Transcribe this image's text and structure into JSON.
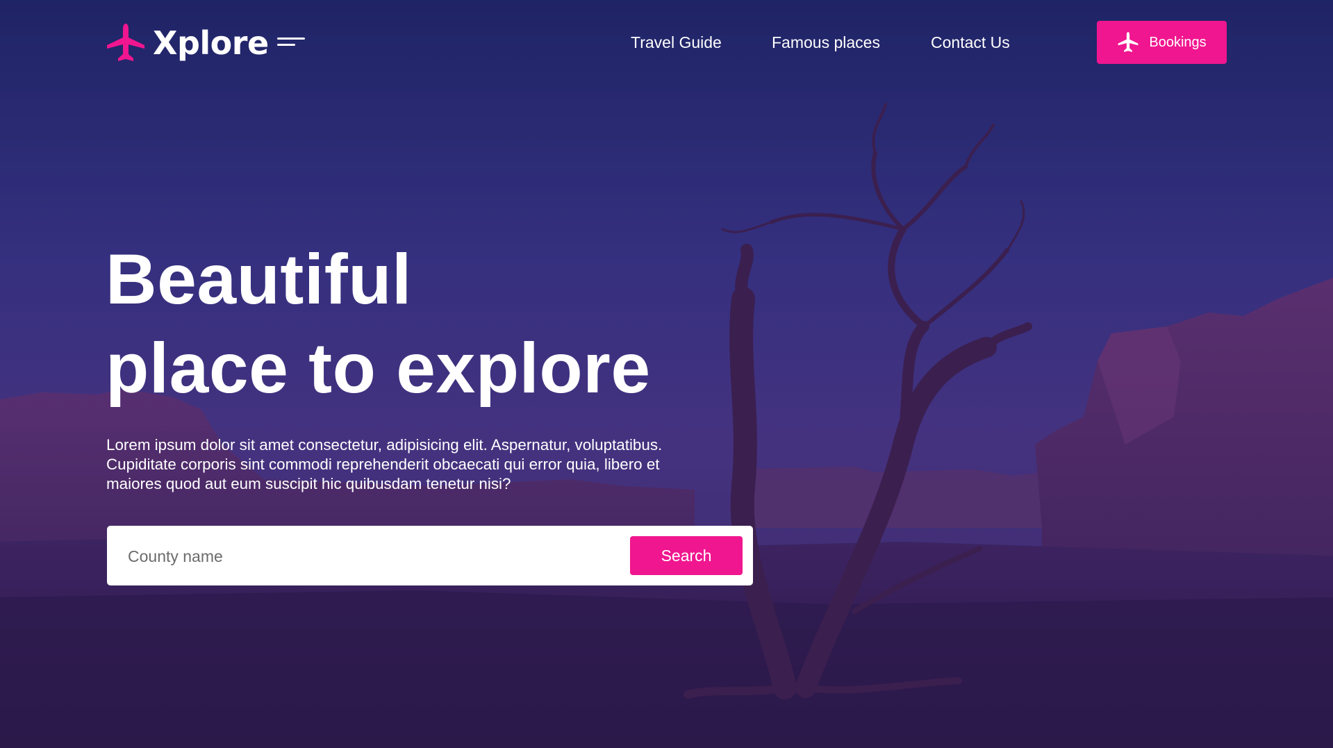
{
  "brand": {
    "name": "Xplore",
    "accent_color": "#f0168f",
    "logo_icon": "airplane-icon",
    "menu_icon": "menu-lines-icon"
  },
  "nav": {
    "links": [
      {
        "label": "Travel Guide"
      },
      {
        "label": "Famous places"
      },
      {
        "label": "Contact Us"
      }
    ],
    "cta": {
      "label": "Bookings",
      "icon": "airplane-icon"
    }
  },
  "hero": {
    "headline_line1": "Beautiful",
    "headline_line2": "place to explore",
    "description": "Lorem ipsum dolor sit amet consectetur, adipisicing elit. Aspernatur, voluptatibus. Cupiditate corporis sint commodi reprehenderit obcaecati qui error quia, libero et maiores quod aut eum suscipit hic quibusdam tenetur nisi?",
    "background": "desert canyon with dead tree at dusk"
  },
  "search": {
    "placeholder": "County name",
    "value": "",
    "button_label": "Search"
  }
}
